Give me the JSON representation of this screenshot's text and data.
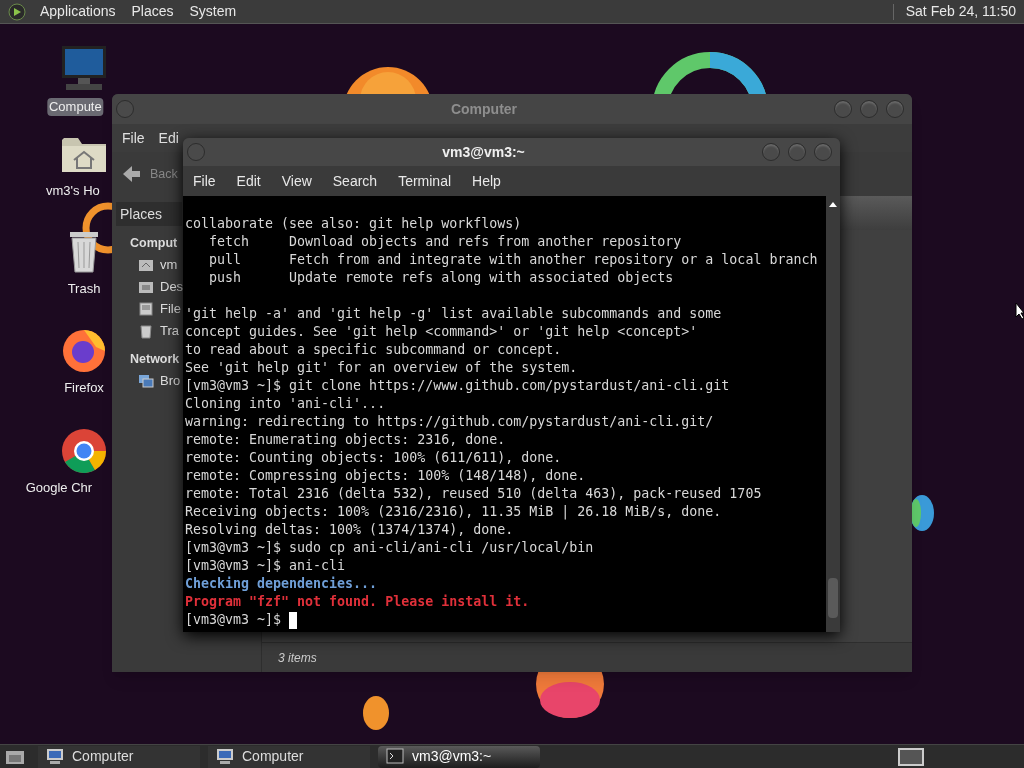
{
  "top_panel": {
    "menus": [
      "Applications",
      "Places",
      "System"
    ],
    "clock": "Sat Feb 24, 11:50"
  },
  "desktop_icons": [
    {
      "label": "Compute",
      "kind": "computer",
      "selected": true
    },
    {
      "label": "vm3's Ho",
      "kind": "home",
      "selected": false
    },
    {
      "label": "Trash",
      "kind": "trash",
      "selected": false
    },
    {
      "label": "Firefox",
      "kind": "firefox",
      "selected": false
    },
    {
      "label": "Google Chr",
      "kind": "chrome",
      "selected": false
    }
  ],
  "file_manager": {
    "title": "Computer",
    "menus": [
      "File",
      "Edi"
    ],
    "back_label": "Back",
    "sidebar_header": "Places",
    "sections": [
      {
        "heading": "Comput",
        "items": [
          {
            "label": "vm",
            "kind": "home"
          },
          {
            "label": "Des",
            "kind": "desktop"
          },
          {
            "label": "File",
            "kind": "drive"
          },
          {
            "label": "Tra",
            "kind": "trash"
          }
        ]
      },
      {
        "heading": "Network",
        "items": [
          {
            "label": "Bro",
            "kind": "network"
          }
        ]
      }
    ],
    "status": "3 items"
  },
  "terminal": {
    "title": "vm3@vm3:~",
    "menus": [
      "File",
      "Edit",
      "View",
      "Search",
      "Terminal",
      "Help"
    ],
    "lines": [
      {
        "kind": "normal",
        "text": "collaborate (see also: git help workflows)"
      },
      {
        "kind": "normal",
        "text": "   fetch     Download objects and refs from another repository"
      },
      {
        "kind": "normal",
        "text": "   pull      Fetch from and integrate with another repository or a local branch"
      },
      {
        "kind": "normal",
        "text": "   push      Update remote refs along with associated objects"
      },
      {
        "kind": "blank"
      },
      {
        "kind": "normal",
        "text": "'git help -a' and 'git help -g' list available subcommands and some"
      },
      {
        "kind": "normal",
        "text": "concept guides. See 'git help <command>' or 'git help <concept>'"
      },
      {
        "kind": "normal",
        "text": "to read about a specific subcommand or concept."
      },
      {
        "kind": "normal",
        "text": "See 'git help git' for an overview of the system."
      },
      {
        "kind": "normal",
        "text": "[vm3@vm3 ~]$ git clone https://www.github.com/pystardust/ani-cli.git"
      },
      {
        "kind": "normal",
        "text": "Cloning into 'ani-cli'..."
      },
      {
        "kind": "normal",
        "text": "warning: redirecting to https://github.com/pystardust/ani-cli.git/"
      },
      {
        "kind": "normal",
        "text": "remote: Enumerating objects: 2316, done."
      },
      {
        "kind": "normal",
        "text": "remote: Counting objects: 100% (611/611), done."
      },
      {
        "kind": "normal",
        "text": "remote: Compressing objects: 100% (148/148), done."
      },
      {
        "kind": "normal",
        "text": "remote: Total 2316 (delta 532), reused 510 (delta 463), pack-reused 1705"
      },
      {
        "kind": "normal",
        "text": "Receiving objects: 100% (2316/2316), 11.35 MiB | 26.18 MiB/s, done."
      },
      {
        "kind": "normal",
        "text": "Resolving deltas: 100% (1374/1374), done."
      },
      {
        "kind": "normal",
        "text": "[vm3@vm3 ~]$ sudo cp ani-cli/ani-cli /usr/local/bin"
      },
      {
        "kind": "normal",
        "text": "[vm3@vm3 ~]$ ani-cli"
      },
      {
        "kind": "info",
        "text": "Checking dependencies..."
      },
      {
        "kind": "error",
        "text": "Program \"fzf\" not found. Please install it."
      },
      {
        "kind": "prompt",
        "text": "[vm3@vm3 ~]$"
      }
    ]
  },
  "taskbar": {
    "tasks": [
      {
        "label": "Computer",
        "kind": "computer",
        "selected": false
      },
      {
        "label": "Computer",
        "kind": "computer",
        "selected": false
      },
      {
        "label": "vm3@vm3:~",
        "kind": "terminal",
        "selected": true
      }
    ]
  }
}
